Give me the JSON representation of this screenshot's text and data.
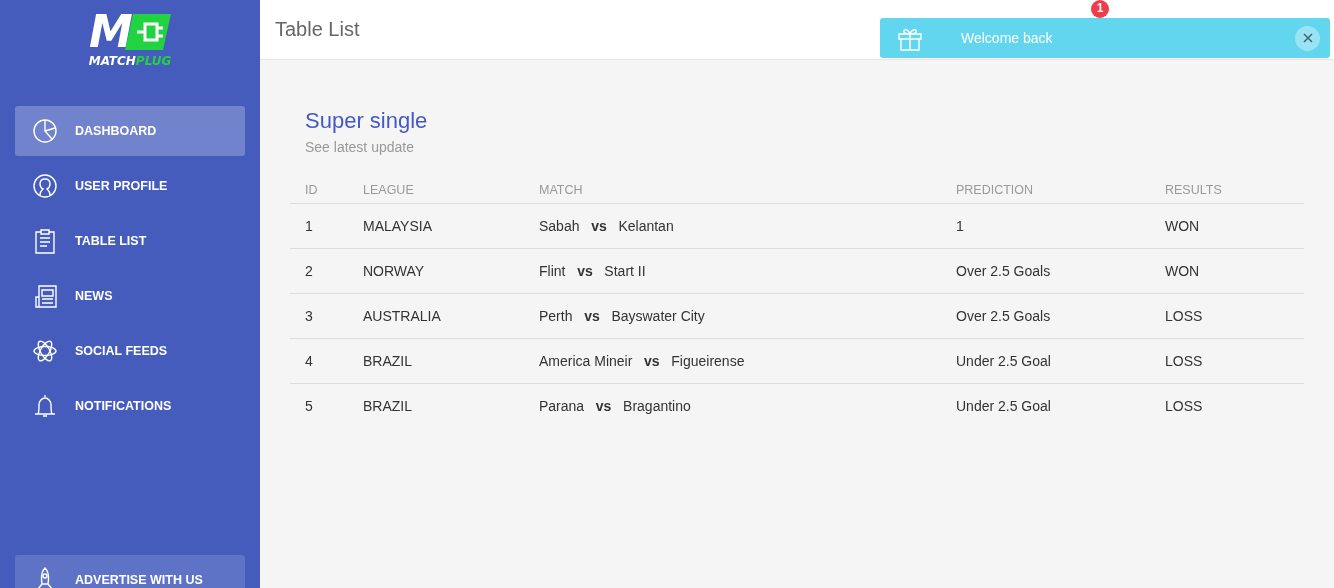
{
  "sidebar": {
    "logo": {
      "mark": "M",
      "word_1": "MATCH",
      "word_2": "PLUG"
    },
    "items": [
      {
        "label": "DASHBOARD",
        "selected": true
      },
      {
        "label": "USER PROFILE",
        "selected": false
      },
      {
        "label": "TABLE LIST",
        "selected": false
      },
      {
        "label": "NEWS",
        "selected": false
      },
      {
        "label": "SOCIAL FEEDS",
        "selected": false
      },
      {
        "label": "NOTIFICATIONS",
        "selected": false
      }
    ],
    "advert": {
      "label": "ADVERTISE WITH US"
    }
  },
  "header": {
    "title": "Table List",
    "badge": "1"
  },
  "toast": {
    "message": "Welcome back"
  },
  "card": {
    "title": "Super single",
    "subtitle": "See latest update",
    "table": {
      "columns": [
        "ID",
        "LEAGUE",
        "MATCH",
        "PREDICTION",
        "RESULTS"
      ],
      "rows": [
        [
          "1",
          "MALAYSIA",
          "Sabah   **vs**   Kelantan",
          "1",
          "WON"
        ],
        [
          "2",
          "NORWAY",
          "Flint   **vs**   Start II",
          "Over 2.5 Goals",
          "WON"
        ],
        [
          "3",
          "AUSTRALIA",
          "Perth   **vs**   Bayswater City",
          "Over 2.5 Goals",
          "LOSS"
        ],
        [
          "4",
          "BRAZIL",
          "America Mineir   **vs**   Figueirense",
          "Under 2.5 Goal",
          "LOSS"
        ],
        [
          "5",
          "BRAZIL",
          "Parana   **vs**   Bragantino",
          "Under 2.5 Goal",
          "LOSS"
        ]
      ]
    }
  }
}
